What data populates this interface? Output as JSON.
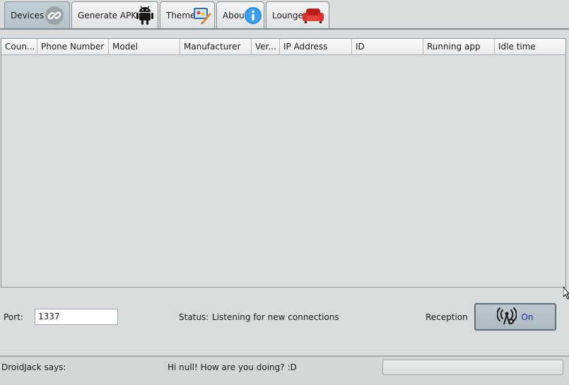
{
  "tabs": [
    {
      "label": "Devices",
      "icon": "link-icon",
      "active": true
    },
    {
      "label": "Generate APK",
      "icon": "android-icon",
      "active": false
    },
    {
      "label": "Theme",
      "icon": "palette-icon",
      "active": false
    },
    {
      "label": "About",
      "icon": "info-icon",
      "active": false
    },
    {
      "label": "Lounge",
      "icon": "sofa-icon",
      "active": false
    }
  ],
  "table": {
    "columns": [
      "Coun...",
      "Phone Number",
      "Model",
      "Manufacturer",
      "Ver...",
      "IP Address",
      "ID",
      "Running app",
      "Idle time"
    ],
    "rows": []
  },
  "server": {
    "port_label": "Port:",
    "port_value": "1337",
    "status_label": "Status:",
    "status_value": "Listening for new connections",
    "reception_label": "Reception",
    "reception_button": "On"
  },
  "footer": {
    "says_label": "DroidJack says:",
    "message": "Hi null! How are you doing? :D"
  },
  "colors": {
    "active_tab": "#bfcbd3",
    "on_text": "#1c2f9e"
  }
}
